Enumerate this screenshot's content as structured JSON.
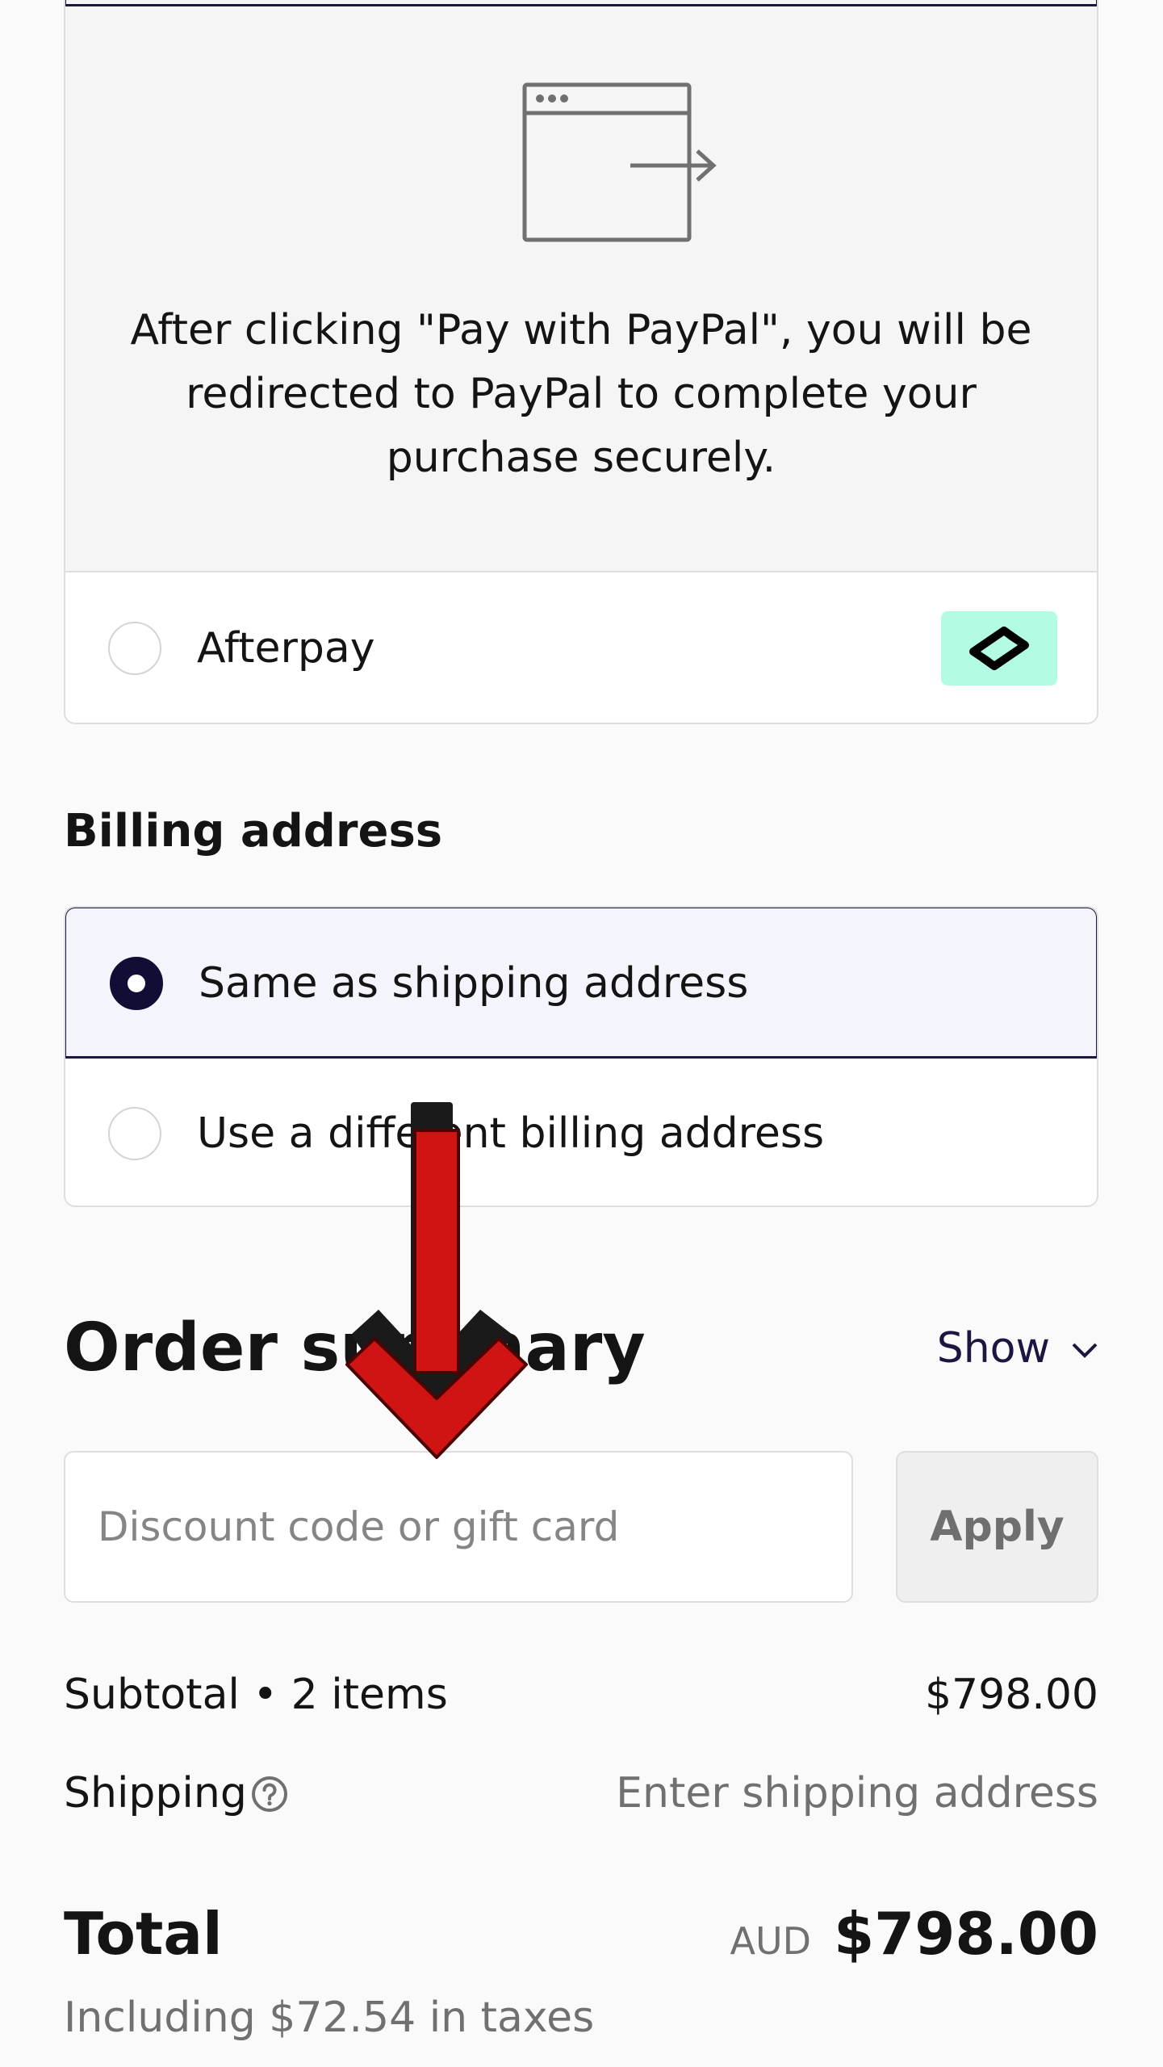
{
  "payment": {
    "paypal_message": "After clicking \"Pay with PayPal\", you will be redirected to PayPal to complete your purchase securely.",
    "afterpay_label": "Afterpay",
    "afterpay_selected": false,
    "icons": {
      "redirect": "browser-redirect-icon",
      "afterpay": "afterpay-logo-icon"
    },
    "colors": {
      "afterpay_brand": "#b2fce4",
      "selected_border": "#1c1640"
    }
  },
  "billing": {
    "heading": "Billing address",
    "options": [
      {
        "label": "Same as shipping address",
        "selected": true
      },
      {
        "label": "Use a different billing address",
        "selected": false
      }
    ]
  },
  "order_summary": {
    "title": "Order summary",
    "toggle_label": "Show",
    "toggle_icon": "chevron-down-icon",
    "discount": {
      "placeholder": "Discount code or gift card",
      "value": "",
      "apply_label": "Apply"
    },
    "subtotal_label": "Subtotal • 2 items",
    "subtotal_value": "$798.00",
    "shipping_label": "Shipping",
    "shipping_help_icon": "question-circle-icon",
    "shipping_value": "Enter shipping address",
    "total_label": "Total",
    "total_currency": "AUD",
    "total_value": "$798.00",
    "tax_note": "Including $72.54 in taxes"
  },
  "overlay": {
    "icon": "red-down-arrow-icon",
    "color": "#d01414"
  }
}
